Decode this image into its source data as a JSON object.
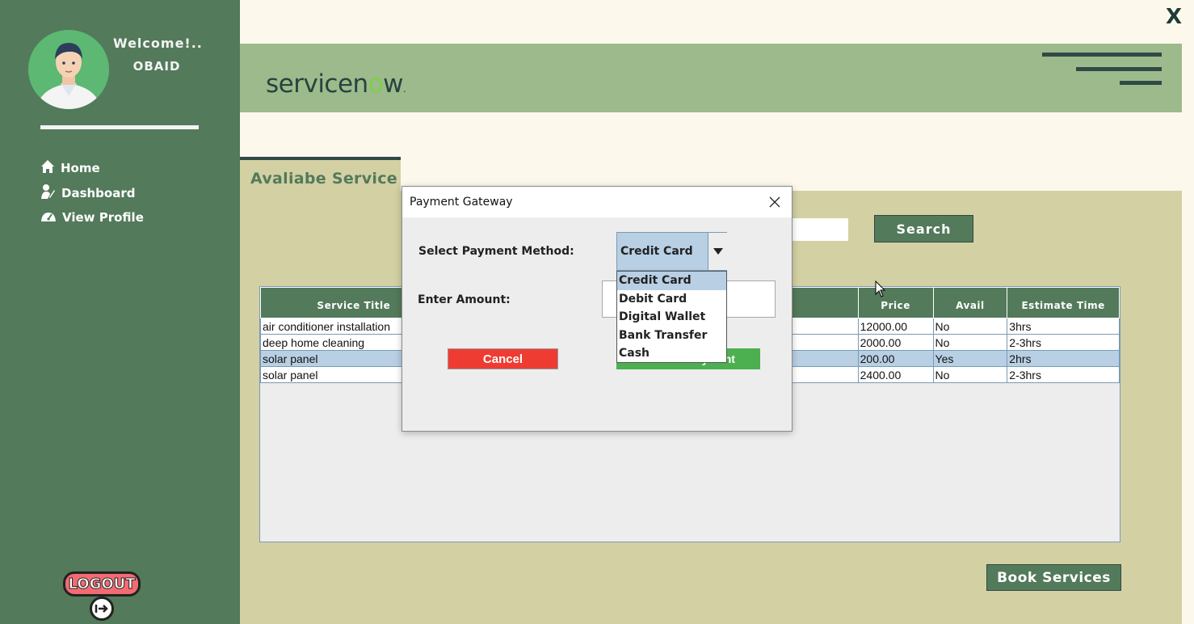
{
  "window": {
    "close_label": "X"
  },
  "sidebar": {
    "welcome": "Welcome!..",
    "username": "OBAID",
    "nav": [
      {
        "label": "Home",
        "icon": "home-icon"
      },
      {
        "label": "Dashboard",
        "icon": "dashboard-icon"
      },
      {
        "label": "View  Profile",
        "icon": "profile-icon"
      }
    ],
    "logout_label": "LOGOUT"
  },
  "header": {
    "logo_prefix": "servicen",
    "logo_o": "o",
    "logo_suffix": "w",
    "logo_mark": ".",
    "menu_icon": "hamburger-menu-icon"
  },
  "main": {
    "section_title": "Avaliabe Service",
    "search_value": "",
    "search_label": "Search",
    "book_label": "Book Services",
    "table": {
      "columns": [
        "Service Title",
        "",
        "Price",
        "Avail",
        "Estimate Time"
      ],
      "rows": [
        {
          "title": "air conditioner installation",
          "price": "12000.00",
          "avail": "No",
          "time": "3hrs",
          "selected": false
        },
        {
          "title": "deep home cleaning",
          "price": "2000.00",
          "avail": "No",
          "time": "2-3hrs",
          "selected": false
        },
        {
          "title": "solar panel",
          "price": "200.00",
          "avail": "Yes",
          "time": "2hrs",
          "selected": true
        },
        {
          "title": "solar panel",
          "price": "2400.00",
          "avail": "No",
          "time": "2-3hrs",
          "selected": false
        }
      ]
    }
  },
  "dialog": {
    "title": "Payment Gateway",
    "method_label": "Select Payment Method:",
    "amount_label": "Enter Amount:",
    "amount_value": "",
    "selected_method": "Credit Card",
    "options": [
      "Credit Card",
      "Debit Card",
      "Digital Wallet",
      "Bank Transfer",
      "Cash"
    ],
    "cancel_label": "Cancel",
    "confirm_label": "Confirm Payment"
  },
  "colors": {
    "sidebar": "#537a5a",
    "header": "#9cba8b",
    "panel": "#d3d0a3",
    "background": "#fdf8ec",
    "cancel": "#ef3c33",
    "confirm": "#4caf50",
    "selection": "#b8cfe4"
  }
}
